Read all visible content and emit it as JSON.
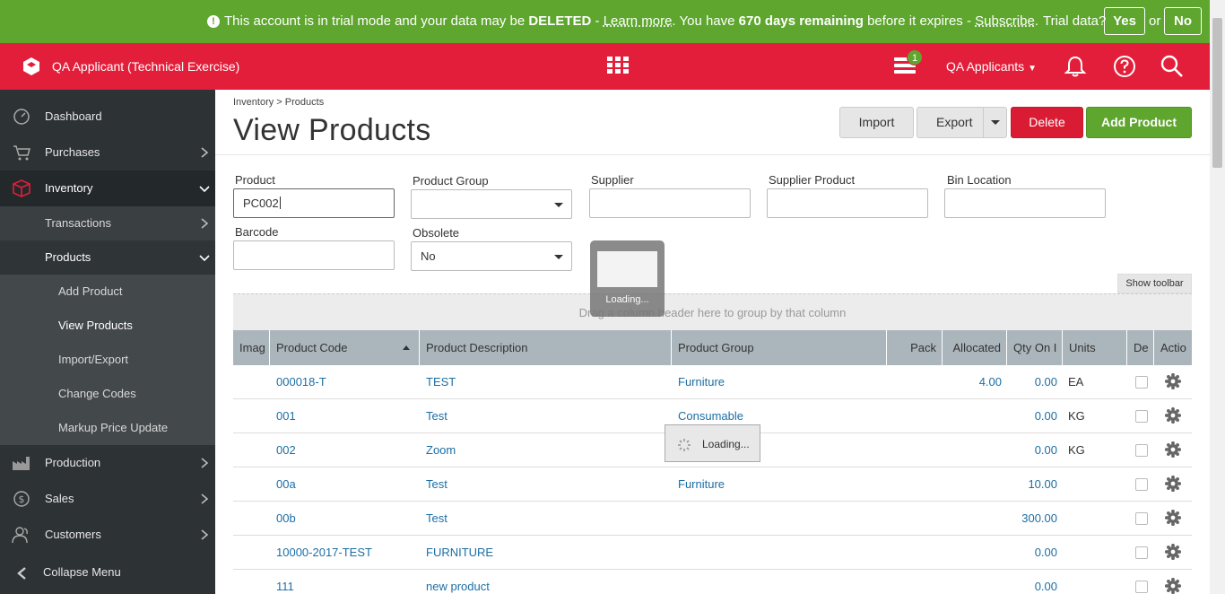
{
  "trial": {
    "pre": "This account is in trial mode and your data may be ",
    "deleted": "DELETED",
    "dash1": " - ",
    "learn": "Learn more",
    "mid": ". You have ",
    "days": "670 days remaining",
    "post": " before it expires - ",
    "subscribe": "Subscribe",
    "end": ".",
    "question": "Trial data?",
    "yes": "Yes",
    "or": "or",
    "no": "No"
  },
  "header": {
    "company": "QA Applicant (Technical Exercise)",
    "badge_count": "1",
    "user_menu": "QA Applicants"
  },
  "sidebar": {
    "items": [
      {
        "label": "Dashboard"
      },
      {
        "label": "Purchases"
      },
      {
        "label": "Inventory"
      },
      {
        "label": "Transactions"
      },
      {
        "label": "Products"
      },
      {
        "label": "Add Product"
      },
      {
        "label": "View Products"
      },
      {
        "label": "Import/Export"
      },
      {
        "label": "Change Codes"
      },
      {
        "label": "Markup Price Update"
      },
      {
        "label": "Production"
      },
      {
        "label": "Sales"
      },
      {
        "label": "Customers"
      }
    ],
    "collapse": "Collapse Menu"
  },
  "page": {
    "breadcrumb": "Inventory > Products",
    "title": "View Products",
    "buttons": {
      "import": "Import",
      "export": "Export",
      "delete": "Delete",
      "add": "Add Product"
    }
  },
  "filters": {
    "product": {
      "label": "Product",
      "value": "PC002"
    },
    "product_group": {
      "label": "Product Group",
      "value": ""
    },
    "supplier": {
      "label": "Supplier",
      "value": ""
    },
    "supplier_product": {
      "label": "Supplier Product",
      "value": ""
    },
    "bin_location": {
      "label": "Bin Location",
      "value": ""
    },
    "barcode": {
      "label": "Barcode",
      "value": ""
    },
    "obsolete": {
      "label": "Obsolete",
      "value": "No"
    }
  },
  "grid": {
    "show_toolbar": "Show toolbar",
    "group_hint": "Drag a column header here to group by that column",
    "columns": [
      "Imag",
      "Product Code",
      "Product Description",
      "Product Group",
      "Pack",
      "Allocated",
      "Qty On I",
      "Units",
      "De",
      "Actio"
    ],
    "rows": [
      {
        "code": "000018-T",
        "desc": "TEST",
        "group": "Furniture",
        "allocated": "4.00",
        "qty": "0.00",
        "units": "EA"
      },
      {
        "code": "001",
        "desc": "Test",
        "group": "Consumable",
        "allocated": "",
        "qty": "0.00",
        "units": "KG"
      },
      {
        "code": "002",
        "desc": "Zoom",
        "group": "",
        "allocated": "",
        "qty": "0.00",
        "units": "KG"
      },
      {
        "code": "00a",
        "desc": "Test",
        "group": "Furniture",
        "allocated": "",
        "qty": "10.00",
        "units": ""
      },
      {
        "code": "00b",
        "desc": "Test",
        "group": "",
        "allocated": "",
        "qty": "300.00",
        "units": ""
      },
      {
        "code": "10000-2017-TEST",
        "desc": "FURNITURE",
        "group": "",
        "allocated": "",
        "qty": "0.00",
        "units": ""
      },
      {
        "code": "111",
        "desc": "new product",
        "group": "",
        "allocated": "",
        "qty": "0.00",
        "units": ""
      }
    ]
  },
  "loading": {
    "overlay_text": "Loading...",
    "grid_text": "Loading..."
  }
}
